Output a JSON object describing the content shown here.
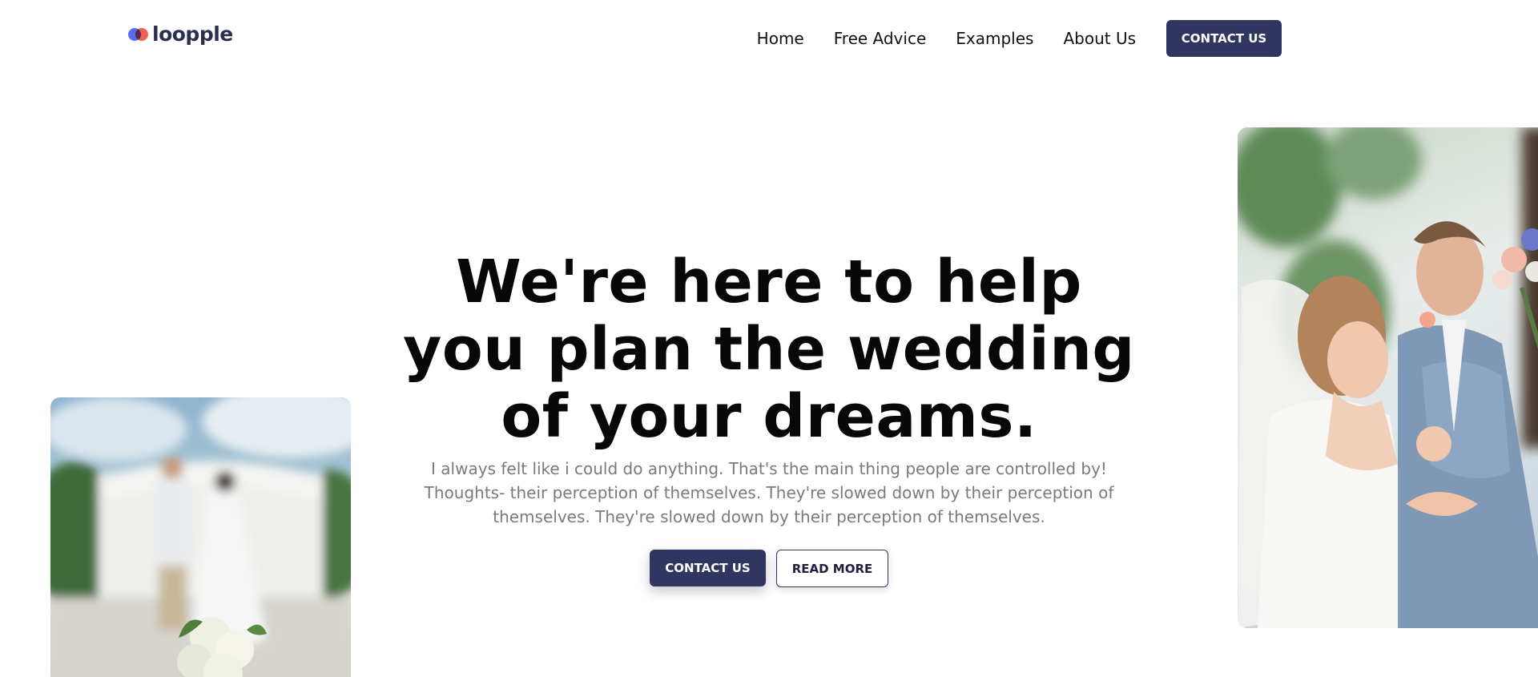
{
  "brand": {
    "name": "loopple"
  },
  "nav": {
    "links": [
      "Home",
      "Free Advice",
      "Examples",
      "About Us"
    ],
    "cta": "CONTACT US"
  },
  "hero": {
    "title": "We're here to help you plan the wedding of your dreams.",
    "text": "I always felt like i could do anything. That's the main thing people are controlled by! Thoughts- their perception of themselves. They're slowed down by their perception of themselves. They're slowed down by their perception of themselves.",
    "primary_button": "CONTACT US",
    "secondary_button": "READ MORE"
  },
  "colors": {
    "accent": "#313660",
    "logo_blue": "#5b6cf0",
    "logo_red": "#f2614f"
  }
}
